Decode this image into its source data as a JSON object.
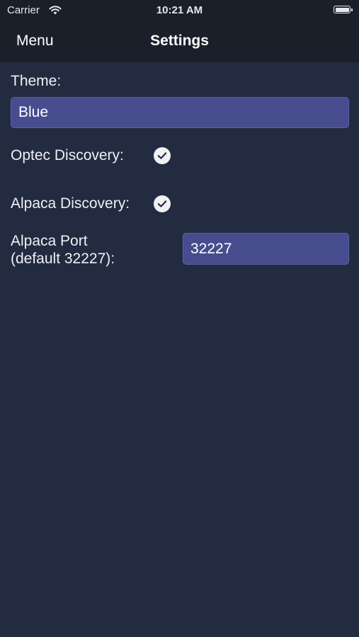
{
  "status_bar": {
    "carrier": "Carrier",
    "time": "10:21 AM",
    "icons": [
      "wifi-icon",
      "battery-icon"
    ]
  },
  "nav": {
    "menu_label": "Menu",
    "title": "Settings"
  },
  "settings": {
    "theme_label": "Theme:",
    "theme_value": "Blue",
    "optec_label": "Optec Discovery:",
    "optec_checked": true,
    "alpaca_label": "Alpaca Discovery:",
    "alpaca_checked": true,
    "port_label_line1": "Alpaca Port",
    "port_label_line2": "(default 32227):",
    "port_value": "32227"
  },
  "colors": {
    "background": "#232b40",
    "nav_background": "#1b1f2a",
    "field_background": "#474c8f",
    "check_fill": "#f0f1f4"
  }
}
